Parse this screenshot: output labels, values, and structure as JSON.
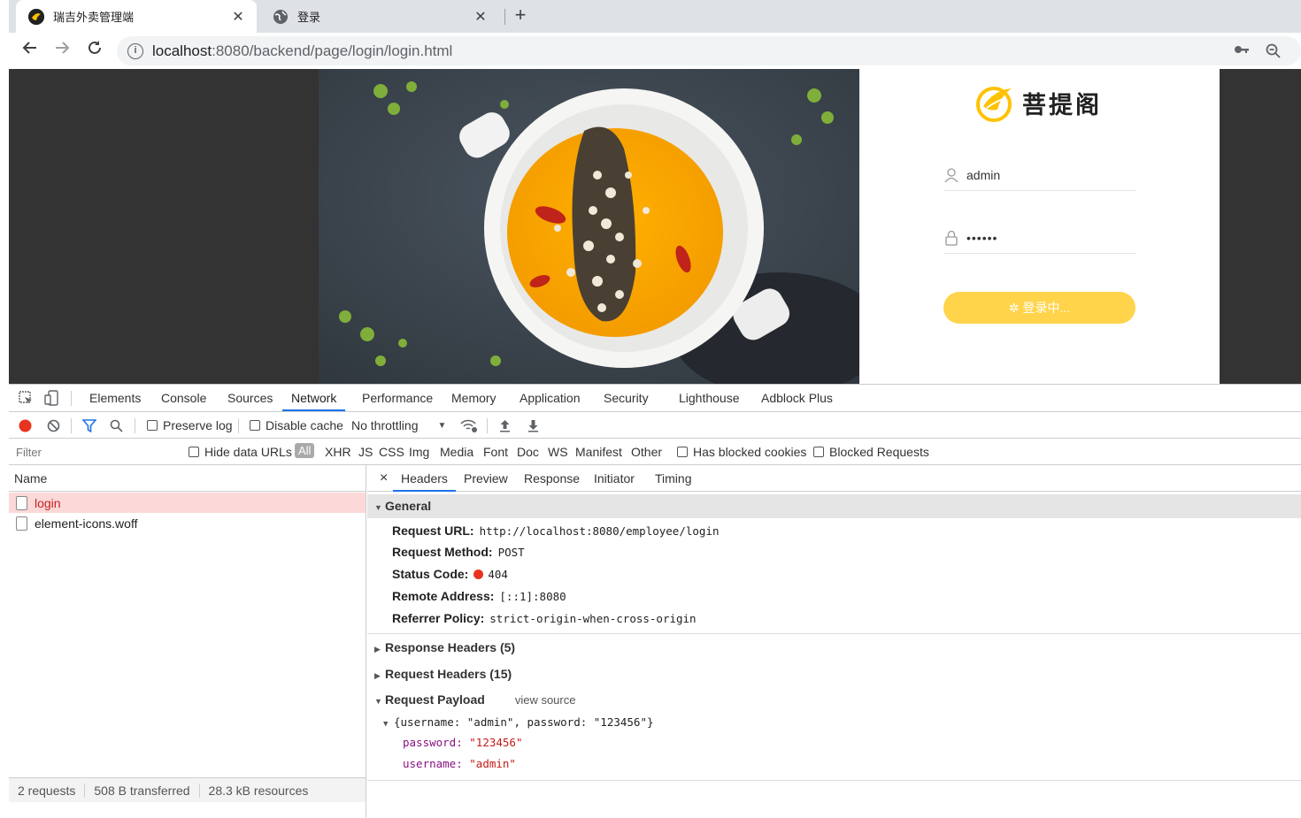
{
  "browser": {
    "tabs": [
      {
        "title": "瑞吉外卖管理端",
        "active": true
      },
      {
        "title": "登录",
        "active": false
      }
    ],
    "new_tab": "+",
    "url_host": "localhost",
    "url_path": ":8080/backend/page/login/login.html"
  },
  "page": {
    "brand_name": "菩提阁",
    "username_value": "admin",
    "password_value": "••••••",
    "login_button": "登录中..."
  },
  "devtools": {
    "tabs": [
      "Elements",
      "Console",
      "Sources",
      "Network",
      "Performance",
      "Memory",
      "Application",
      "Security",
      "Lighthouse",
      "Adblock Plus"
    ],
    "active_tab": "Network",
    "toolbar": {
      "preserve_log": "Preserve log",
      "disable_cache": "Disable cache",
      "throttling": "No throttling"
    },
    "filter": {
      "placeholder": "Filter",
      "hide_data_urls": "Hide data URLs",
      "types": [
        "All",
        "XHR",
        "JS",
        "CSS",
        "Img",
        "Media",
        "Font",
        "Doc",
        "WS",
        "Manifest",
        "Other"
      ],
      "has_blocked_cookies": "Has blocked cookies",
      "blocked_requests": "Blocked Requests"
    },
    "requests": {
      "header": "Name",
      "rows": [
        "login",
        "element-icons.woff"
      ],
      "footer": [
        "2 requests",
        "508 B transferred",
        "28.3 kB resources"
      ]
    },
    "detail": {
      "tabs": [
        "Headers",
        "Preview",
        "Response",
        "Initiator",
        "Timing"
      ],
      "close": "×",
      "general_title": "General",
      "general": [
        {
          "k": "Request URL:",
          "v": "http://localhost:8080/employee/login"
        },
        {
          "k": "Request Method:",
          "v": "POST"
        },
        {
          "k": "Status Code:",
          "v": "404"
        },
        {
          "k": "Remote Address:",
          "v": "[::1]:8080"
        },
        {
          "k": "Referrer Policy:",
          "v": "strict-origin-when-cross-origin"
        }
      ],
      "response_headers": "Response Headers (5)",
      "request_headers": "Request Headers (15)",
      "payload_title": "Request Payload",
      "view_source": "view source",
      "payload_summary": "{username: \"admin\", password: \"123456\"}",
      "payload_password_key": "password:",
      "payload_password_val": "\"123456\"",
      "payload_username_key": "username:",
      "payload_username_val": "\"admin\""
    }
  },
  "colors": {
    "accent_blue": "#1a73e8",
    "login_yellow": "#ffc200",
    "status_red": "#e8331f",
    "selected_row": "#fcd8d8"
  }
}
